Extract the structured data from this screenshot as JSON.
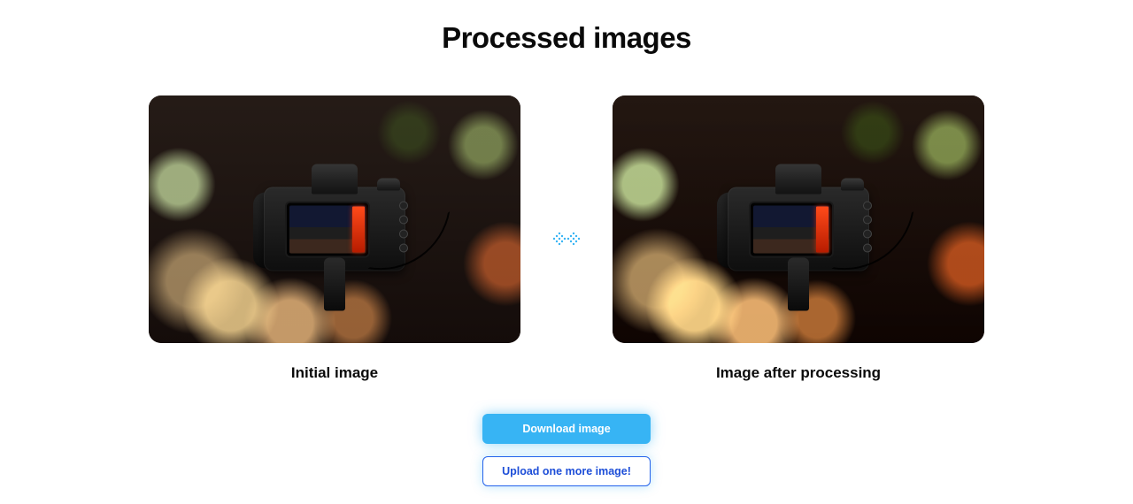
{
  "title": "Processed images",
  "panels": {
    "before": {
      "caption": "Initial image",
      "subject": "DSLR camera on tripod, bokeh night scene"
    },
    "after": {
      "caption": "Image after processing",
      "subject": "DSLR camera on tripod, bokeh night scene (enhanced)"
    }
  },
  "arrow_icon": "dotted-double-arrow-right",
  "actions": {
    "download_label": "Download image",
    "upload_more_label": "Upload one more image!"
  },
  "colors": {
    "accent": "#37b4f4",
    "secondary_border": "#2563eb",
    "secondary_text": "#1d4ed8"
  }
}
